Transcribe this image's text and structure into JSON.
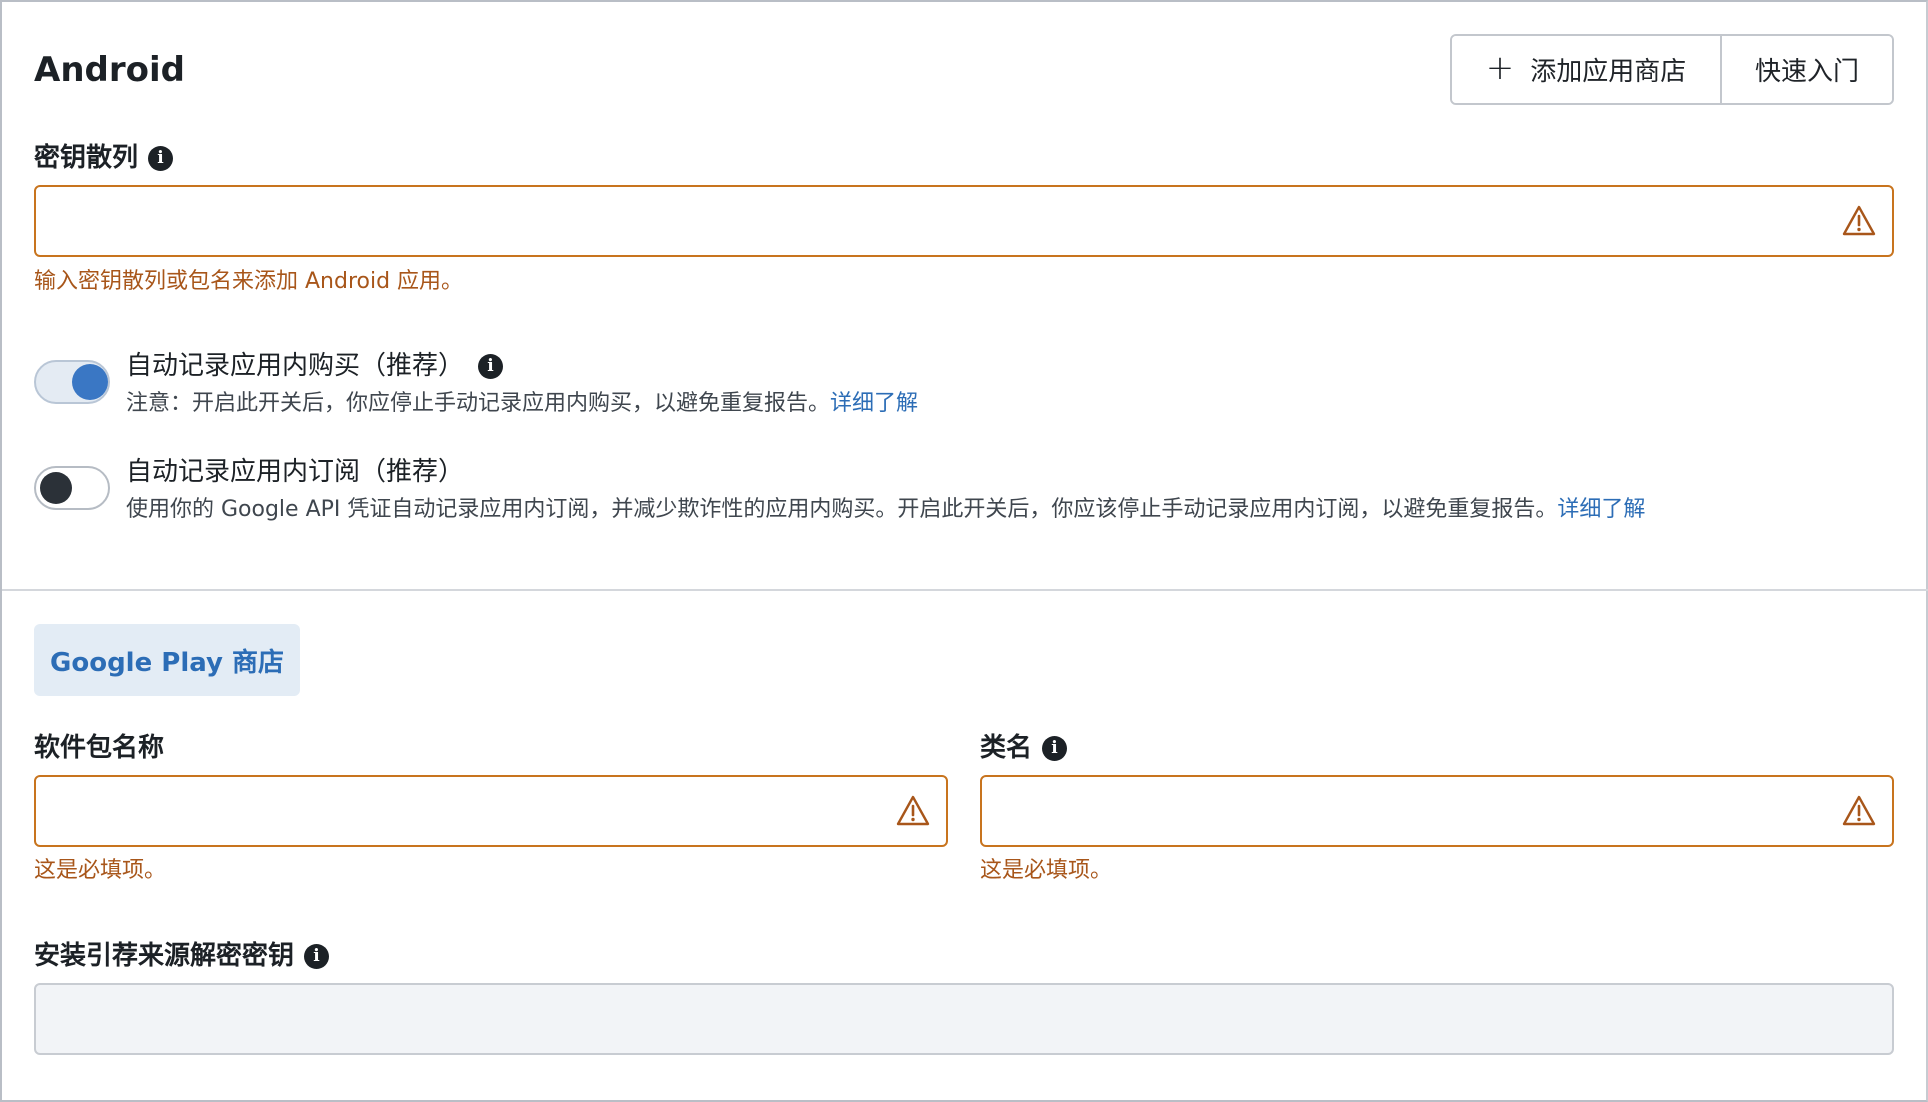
{
  "header": {
    "title": "Android",
    "add_store_label": "添加应用商店",
    "quick_start_label": "快速入门"
  },
  "key_hash": {
    "label": "密钥散列",
    "value": "",
    "error": "输入密钥散列或包名来添加 Android 应用。"
  },
  "toggles": [
    {
      "title": "自动记录应用内购买（推荐）",
      "desc": "注意：开启此开关后，你应停止手动记录应用内购买，以避免重复报告。",
      "link": "详细了解",
      "on": true
    },
    {
      "title": "自动记录应用内订阅（推荐）",
      "desc": "使用你的 Google API 凭证自动记录应用内订阅，并减少欺诈性的应用内购买。开启此开关后，你应该停止手动记录应用内订阅，以避免重复报告。",
      "link": "详细了解",
      "on": false
    }
  ],
  "store_tab": {
    "label": "Google Play 商店"
  },
  "package_name": {
    "label": "软件包名称",
    "value": "",
    "error": "这是必填项。"
  },
  "class_name": {
    "label": "类名",
    "value": "",
    "error": "这是必填项。"
  },
  "install_referrer": {
    "label": "安装引荐来源解密密钥",
    "value": ""
  },
  "colors": {
    "accent": "#3a77c4",
    "link": "#2c6db6",
    "error": "#a8561a",
    "warning_border": "#c8741e"
  },
  "icons": {
    "info": "info-icon",
    "warning": "warning-triangle-icon",
    "plus": "plus-icon"
  }
}
